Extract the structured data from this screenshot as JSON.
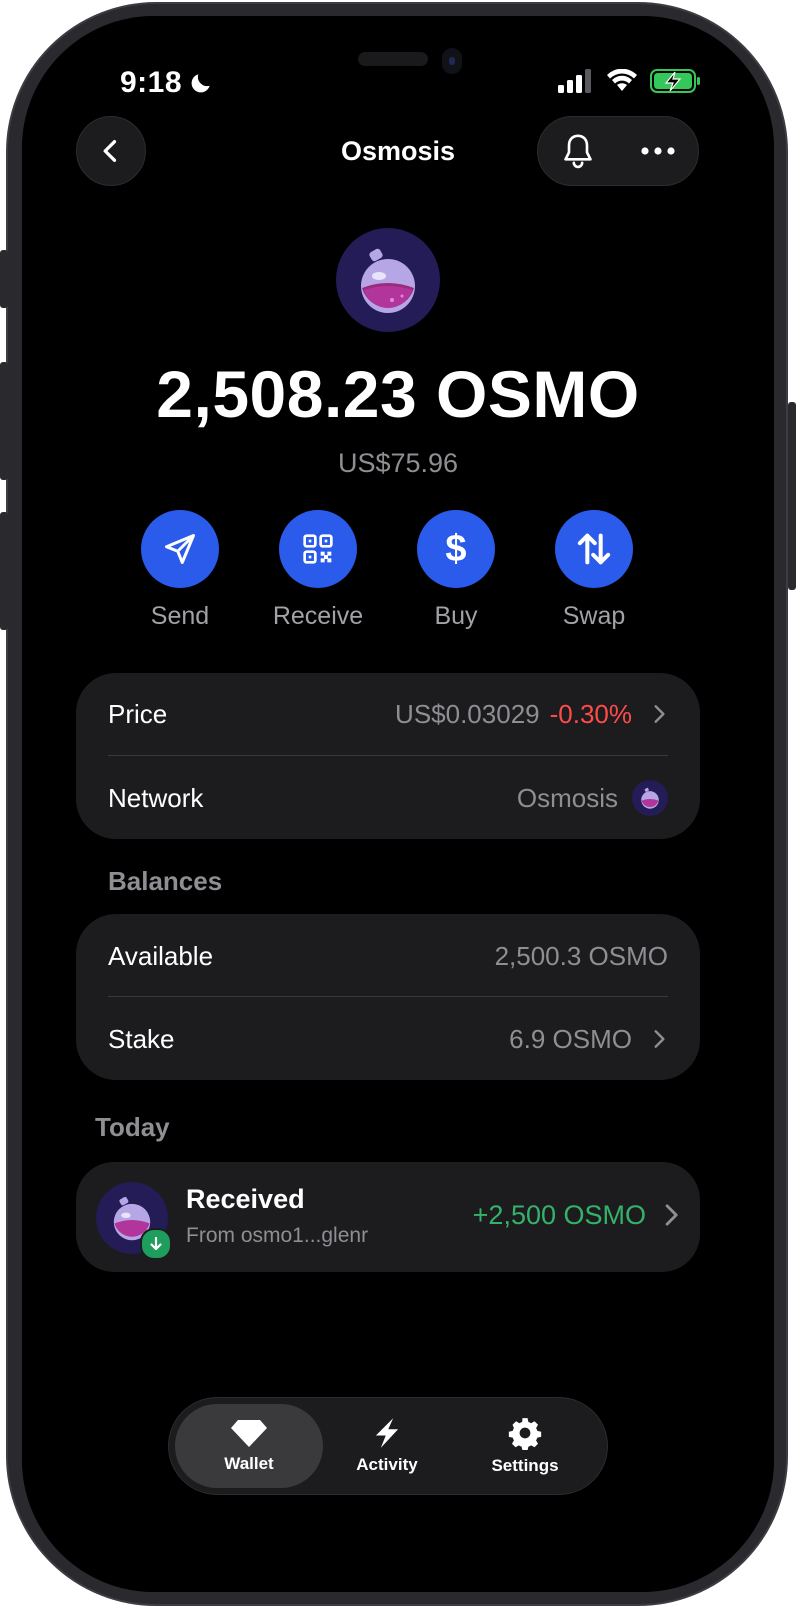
{
  "status_bar": {
    "time": "9:18"
  },
  "nav": {
    "title": "Osmosis"
  },
  "token": {
    "balance": "2,508.23 OSMO",
    "fiat_value": "US$75.96"
  },
  "actions": [
    {
      "label": "Send",
      "icon": "send-icon"
    },
    {
      "label": "Receive",
      "icon": "qr-code-icon"
    },
    {
      "label": "Buy",
      "icon": "dollar-icon"
    },
    {
      "label": "Swap",
      "icon": "swap-arrows-icon"
    }
  ],
  "info": {
    "price_label": "Price",
    "price_value": "US$0.03029",
    "price_change": "-0.30%",
    "network_label": "Network",
    "network_value": "Osmosis"
  },
  "balances": {
    "section_title": "Balances",
    "available_label": "Available",
    "available_value": "2,500.3 OSMO",
    "stake_label": "Stake",
    "stake_value": "6.9 OSMO"
  },
  "activity": {
    "section_title": "Today",
    "items": [
      {
        "title": "Received",
        "subtitle": "From osmo1...glenr",
        "amount": "+2,500 OSMO"
      }
    ]
  },
  "tabbar": {
    "tabs": [
      {
        "label": "Wallet",
        "icon": "diamond-icon",
        "active": true
      },
      {
        "label": "Activity",
        "icon": "lightning-icon",
        "active": false
      },
      {
        "label": "Settings",
        "icon": "gear-icon",
        "active": false
      }
    ]
  },
  "colors": {
    "accent": "#2a5bea",
    "negative": "#ff4a4a",
    "positive": "#35b26a",
    "card": "#1c1c1e",
    "background": "#000000"
  }
}
